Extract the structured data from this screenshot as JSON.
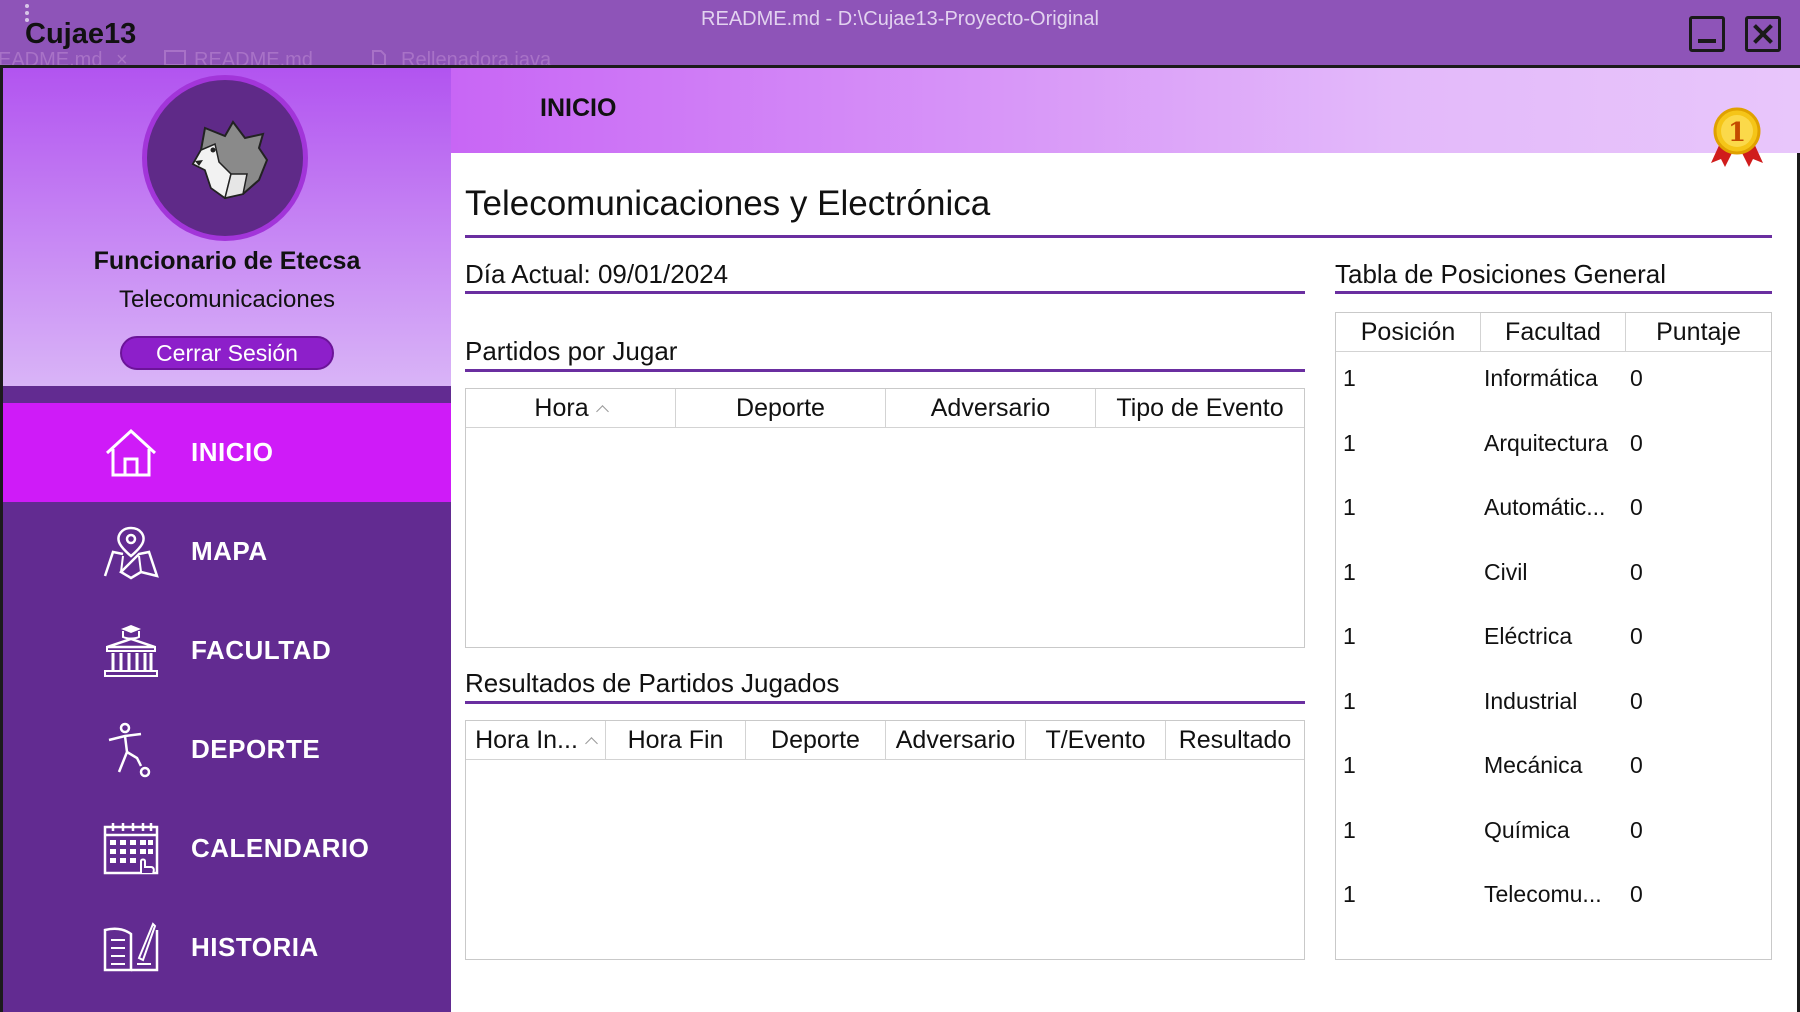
{
  "window": {
    "app_name": "Cujae13",
    "title": "README.md - D:\\Cujae13-Proyecto-Original",
    "background_tabs": [
      "EADME.md",
      "README.md",
      "Rellenadora.java"
    ],
    "background_tab_close": "×"
  },
  "sidebar": {
    "user_name": "Funcionario de Etecsa",
    "user_faculty": "Telecomunicaciones",
    "logout_label": "Cerrar Sesión",
    "nav": [
      {
        "label": "INICIO",
        "icon": "home-icon",
        "active": true
      },
      {
        "label": "MAPA",
        "icon": "map-icon",
        "active": false
      },
      {
        "label": "FACULTAD",
        "icon": "building-icon",
        "active": false
      },
      {
        "label": "DEPORTE",
        "icon": "soccer-player-icon",
        "active": false
      },
      {
        "label": "CALENDARIO",
        "icon": "calendar-icon",
        "active": false
      },
      {
        "label": "HISTORIA",
        "icon": "book-icon",
        "active": false
      }
    ]
  },
  "header": {
    "title": "INICIO"
  },
  "main": {
    "title": "Telecomunicaciones y Electrónica",
    "medal_text": "1",
    "current_day": "Día Actual: 09/01/2024",
    "upcoming": {
      "label": "Partidos por Jugar",
      "columns": [
        "Hora",
        "Deporte",
        "Adversario",
        "Tipo de Evento"
      ],
      "rows": []
    },
    "results": {
      "label": "Resultados de Partidos Jugados",
      "columns": [
        "Hora In...",
        "Hora Fin",
        "Deporte",
        "Adversario",
        "T/Evento",
        "Resultado"
      ],
      "rows": []
    },
    "standings": {
      "label": "Tabla de Posiciones General",
      "columns": [
        "Posición",
        "Facultad",
        "Puntaje"
      ],
      "rows": [
        {
          "pos": "1",
          "faculty": "Informática",
          "score": "0"
        },
        {
          "pos": "1",
          "faculty": "Arquitectura",
          "score": "0"
        },
        {
          "pos": "1",
          "faculty": "Automátic...",
          "score": "0"
        },
        {
          "pos": "1",
          "faculty": "Civil",
          "score": "0"
        },
        {
          "pos": "1",
          "faculty": "Eléctrica",
          "score": "0"
        },
        {
          "pos": "1",
          "faculty": "Industrial",
          "score": "0"
        },
        {
          "pos": "1",
          "faculty": "Mecánica",
          "score": "0"
        },
        {
          "pos": "1",
          "faculty": "Química",
          "score": "0"
        },
        {
          "pos": "1",
          "faculty": "Telecomu...",
          "score": "0"
        }
      ]
    }
  },
  "colors": {
    "sidebar_bg": "#622b91",
    "nav_active": "#cf1bf8",
    "accent_line": "#6a2ea0",
    "logout_bg": "#8d1fca"
  }
}
